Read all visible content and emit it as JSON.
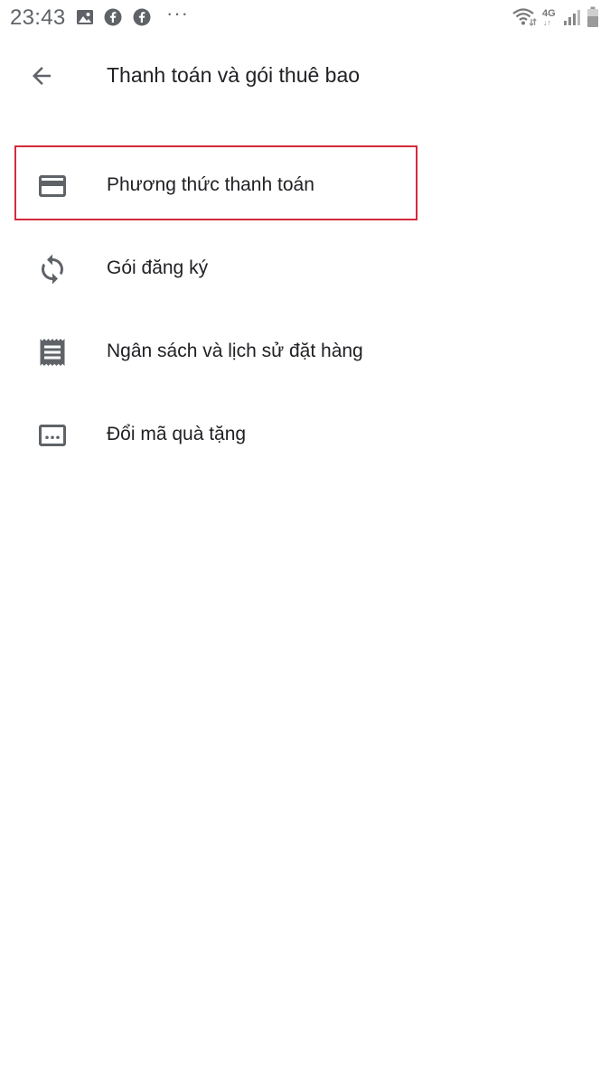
{
  "status_bar": {
    "time": "23:43",
    "dots": "···",
    "network": "4G",
    "network_arrows": "↓↑",
    "icons": [
      "image-icon",
      "facebook-icon",
      "facebook-icon",
      "wifi-icon",
      "signal-icon",
      "battery-icon"
    ]
  },
  "app_bar": {
    "title": "Thanh toán và gói thuê bao",
    "back_icon": "arrow-back-icon"
  },
  "menu": {
    "items": [
      {
        "label": "Phương thức thanh toán",
        "icon": "credit-card-icon",
        "highlighted": true
      },
      {
        "label": "Gói đăng ký",
        "icon": "sync-icon",
        "highlighted": false
      },
      {
        "label": "Ngân sách và lịch sử đặt hàng",
        "icon": "receipt-icon",
        "highlighted": false
      },
      {
        "label": "Đổi mã quà tặng",
        "icon": "redeem-code-icon",
        "highlighted": false
      }
    ]
  },
  "colors": {
    "text_primary": "#202124",
    "icon_gray": "#5f6368",
    "highlight_red": "#d42a3c",
    "background": "#ffffff"
  }
}
